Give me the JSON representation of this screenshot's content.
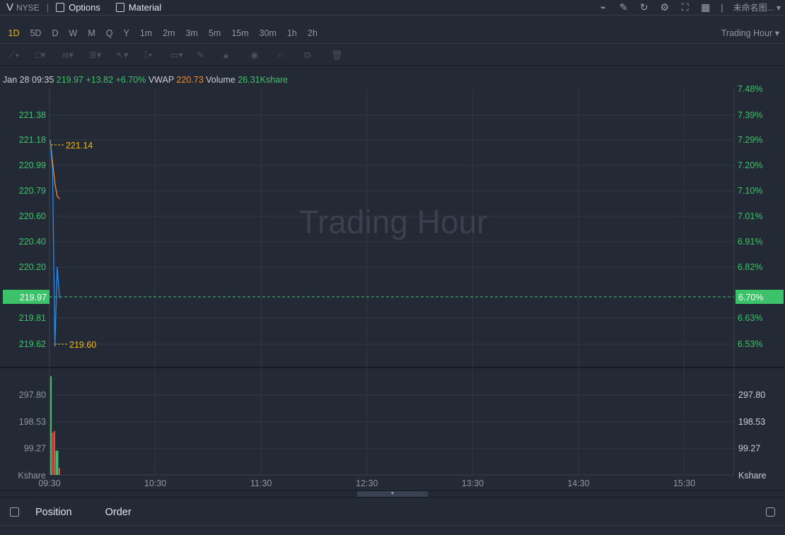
{
  "header": {
    "symbol": "V",
    "exchange": "NYSE",
    "menus": [
      "Options",
      "Material"
    ],
    "layout_name": "未命名图...",
    "icons": [
      "indicator-icon",
      "draw-icon",
      "refresh-icon",
      "settings-icon",
      "fullscreen-icon",
      "layout-grid-icon"
    ]
  },
  "periods": {
    "items": [
      "1D",
      "5D",
      "D",
      "W",
      "M",
      "Q",
      "Y",
      "1m",
      "2m",
      "3m",
      "5m",
      "15m",
      "30m",
      "1h",
      "2h"
    ],
    "active": "1D",
    "session": "Trading Hour"
  },
  "tools": [
    "line-tool-icon",
    "rectangle-tool-icon",
    "pattern-tool-icon",
    "fib-tool-icon",
    "arrow-tool-icon",
    "measure-tool-icon",
    "label-tool-icon",
    "pen-icon",
    "lock-icon",
    "eye-icon",
    "magnet-icon",
    "copy-icon",
    "trash-icon"
  ],
  "info": {
    "datetime": "Jan 28 09:35",
    "price": "219.97",
    "change": "+13.82",
    "change_pct": "+6.70%",
    "vwap_label": "VWAP",
    "vwap": "220.73",
    "volume_label": "Volume",
    "volume": "26.31Kshare"
  },
  "watermark": "Trading Hour",
  "colors": {
    "up": "#3cc36a",
    "down": "#f24646",
    "price_line": "#2a8cf0",
    "vwap_line": "#f28b2b",
    "marker": "#f0b90b"
  },
  "chart_data": {
    "type": "line",
    "price_axis_left": [
      "221.38",
      "221.18",
      "220.99",
      "220.79",
      "220.60",
      "220.40",
      "220.20",
      "219.81",
      "219.62"
    ],
    "price_axis_right": [
      "7.48%",
      "7.39%",
      "7.29%",
      "7.20%",
      "7.10%",
      "7.01%",
      "6.91%",
      "6.82%",
      "6.63%",
      "6.53%"
    ],
    "current_price": "219.97",
    "current_pct": "6.70%",
    "high_label": "221.14",
    "low_label": "219.60",
    "x_ticks": [
      "09:30",
      "10:30",
      "11:30",
      "12:30",
      "13:30",
      "14:30",
      "15:30"
    ],
    "price_series": [
      {
        "t": 0,
        "v": 221.17
      },
      {
        "t": 1,
        "v": 220.95
      },
      {
        "t": 2,
        "v": 219.6
      },
      {
        "t": 3,
        "v": 220.21
      },
      {
        "t": 4,
        "v": 219.97
      }
    ],
    "vwap_series": [
      {
        "t": 0,
        "v": 221.18
      },
      {
        "t": 2,
        "v": 220.85
      },
      {
        "t": 3,
        "v": 220.75
      },
      {
        "t": 4,
        "v": 220.73
      }
    ],
    "volume_axis": [
      "297.80",
      "198.53",
      "99.27"
    ],
    "volume_unit": "Kshare",
    "volume": [
      {
        "t": 0,
        "v": 369,
        "dir": "up"
      },
      {
        "t": 1,
        "v": 158,
        "dir": "down"
      },
      {
        "t": 2,
        "v": 164,
        "dir": "down"
      },
      {
        "t": 3,
        "v": 90,
        "dir": "up"
      },
      {
        "t": 4,
        "v": 91,
        "dir": "up"
      },
      {
        "t": 5,
        "v": 26,
        "dir": "down"
      }
    ]
  },
  "footer": {
    "tabs": [
      "Position",
      "Order"
    ]
  }
}
